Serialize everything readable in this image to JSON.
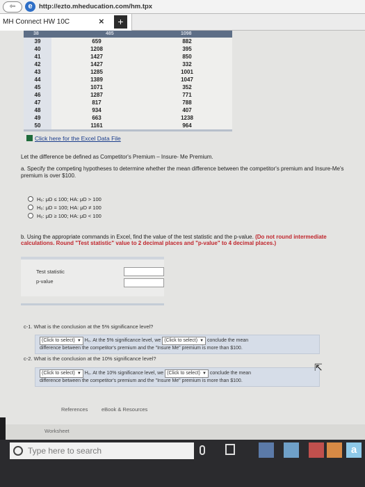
{
  "browser": {
    "address": "http://ezto.mheducation.com/hm.tpx",
    "tab_title": "MH Connect HW 10C",
    "tab_close": "×",
    "new_tab": "+",
    "back_label": "⇦"
  },
  "table": {
    "header_cells": [
      "38",
      "485",
      "1098"
    ],
    "rows": [
      {
        "n": "39",
        "a": "659",
        "b": "882"
      },
      {
        "n": "40",
        "a": "1208",
        "b": "395"
      },
      {
        "n": "41",
        "a": "1427",
        "b": "850"
      },
      {
        "n": "42",
        "a": "1427",
        "b": "332"
      },
      {
        "n": "43",
        "a": "1285",
        "b": "1001"
      },
      {
        "n": "44",
        "a": "1389",
        "b": "1047"
      },
      {
        "n": "45",
        "a": "1071",
        "b": "352"
      },
      {
        "n": "46",
        "a": "1287",
        "b": "771"
      },
      {
        "n": "47",
        "a": "817",
        "b": "788"
      },
      {
        "n": "48",
        "a": "934",
        "b": "407"
      },
      {
        "n": "49",
        "a": "663",
        "b": "1238"
      },
      {
        "n": "50",
        "a": "1161",
        "b": "964"
      }
    ]
  },
  "excel_link": "Click here for the Excel Data File",
  "definition": "Let the difference be defined as Competitor's Premium – Insure- Me Premium.",
  "question_a": {
    "text": "a. Specify the competing hypotheses to determine whether the mean difference between the competitor's premium and Insure-Me's premium is over $100.",
    "options": [
      "H₀: μD ≤ 100; HA: μD > 100",
      "H₀: μD = 100; HA: μD ≠ 100",
      "H₀: μD ≥ 100; HA: μD < 100"
    ]
  },
  "question_b": {
    "text": "b. Using the appropriate commands in Excel, find the value of the test statistic and the p-value.",
    "note": "(Do not round intermediate calculations. Round \"Test statistic\" value to 2 decimal places and \"p-value\" to 4 decimal places.)",
    "label_stat": "Test statistic",
    "label_p": "p-value"
  },
  "question_c1": {
    "text": "c-1. What is the conclusion at the 5% significance level?",
    "select1": "(Click to select)",
    "mid": "H₀. At the 5% significance level, we",
    "select2": "(Click to select)",
    "tail": "conclude the mean",
    "line2": "difference between the competitor's premium and the \"Insure Me\" premium is more than $100."
  },
  "question_c2": {
    "text": "c-2. What is the conclusion at the 10% significance level?",
    "select1": "(Click to select)",
    "mid": "H₀. At the 10% significance level, we",
    "select2": "(Click to select)",
    "tail": "conclude the mean",
    "line2": "difference between the competitor's premium and the \"Insure Me\" premium is more than $100."
  },
  "bottom_tabs": {
    "references": "References",
    "ebook": "eBook & Resources"
  },
  "worksheet_label": "Worksheet",
  "taskbar": {
    "search_placeholder": "Type here to search",
    "a_label": "a"
  }
}
